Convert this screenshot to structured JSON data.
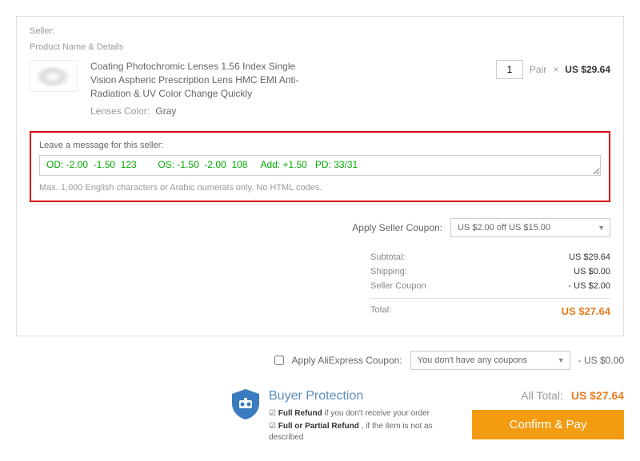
{
  "header": {
    "seller": "Seller:",
    "details": "Product Name & Details"
  },
  "product": {
    "title": "Coating Photochromic Lenses 1.56 Index Single Vision Aspheric Prescription Lens HMC EMI Anti-Radiation & UV Color Change Quickly",
    "variant_label": "Lenses Color:",
    "variant_value": "Gray"
  },
  "qty": {
    "value": "1",
    "unit": "Pair",
    "times": "×",
    "price": "US $29.64"
  },
  "message": {
    "title": "Leave a message for this seller:",
    "value": "OD: -2.00  -1.50  123        OS: -1.50  -2.00  108     Add: +1.50   PD: 33/31",
    "hint": "Max. 1,000 English characters or Arabic numerals only. No HTML codes."
  },
  "seller_coupon": {
    "label": "Apply Seller Coupon:",
    "selected": "US $2.00 off US $15.00"
  },
  "totals": {
    "subtotal_label": "Subtotal:",
    "subtotal_val": "US $29.64",
    "shipping_label": "Shipping:",
    "shipping_val": "US $0.00",
    "coupon_label": "Seller Coupon",
    "coupon_val": "- US $2.00",
    "total_label": "Total:",
    "total_val": "US $27.64"
  },
  "ax_coupon": {
    "label": "Apply AliExpress Coupon:",
    "selected": "You don't have any coupons",
    "value": "- US $0.00"
  },
  "bp": {
    "title": "Buyer Protection",
    "line1_b": "Full Refund",
    "line1_t": " if you don't receive your order",
    "line2_b": "Full or Partial Refund",
    "line2_t": " , if the item is not as described"
  },
  "checkout": {
    "alltotal_label": "All Total:",
    "alltotal_val": "US $27.64",
    "btn": "Confirm & Pay"
  }
}
